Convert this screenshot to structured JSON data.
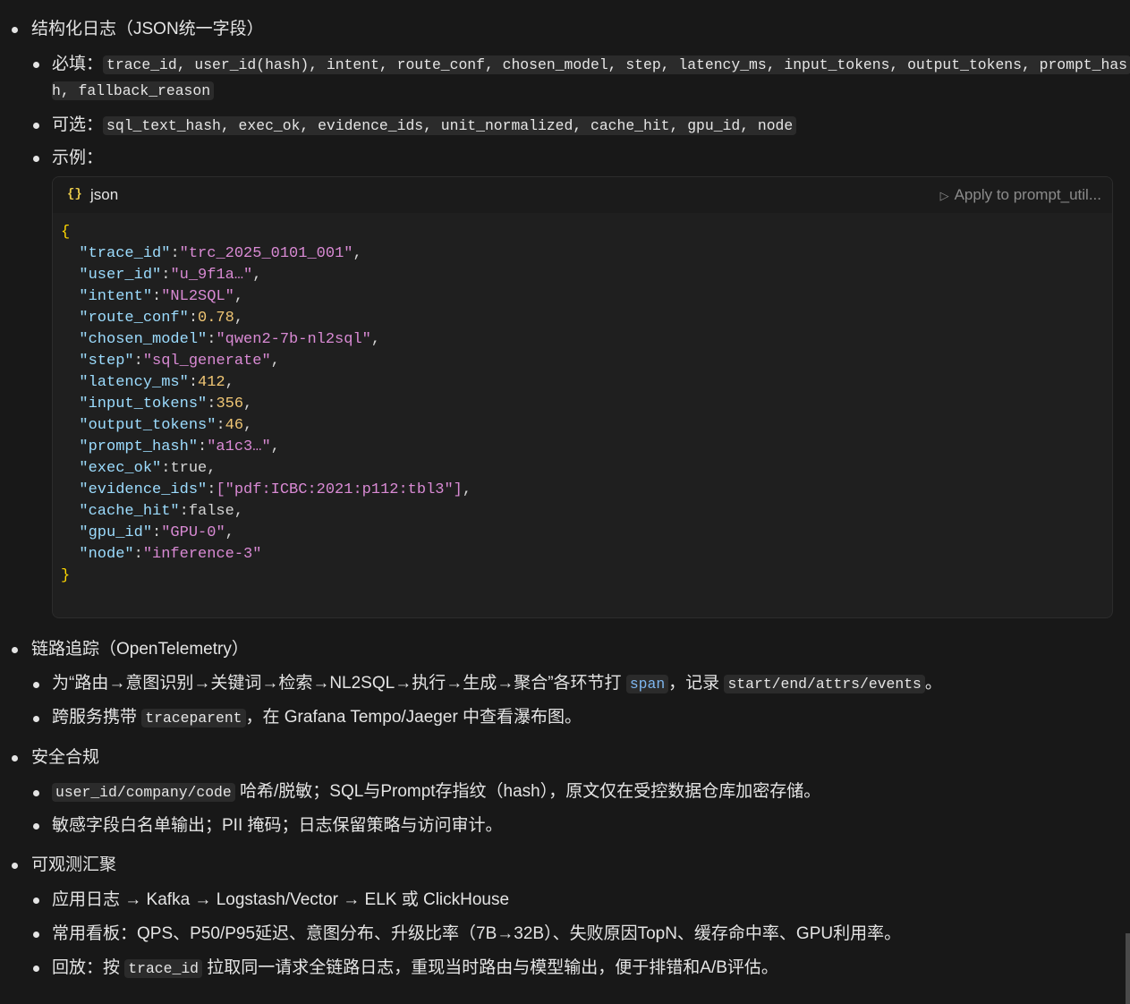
{
  "sections": {
    "structured_log": {
      "title": "结构化日志（JSON统一字段）",
      "required_label": "必填：",
      "required_fields_1": "trace_id, user_id(hash), intent, route_conf, chosen_model, step, latency_ms, input_tokens, output_tokens, prompt_has",
      "required_fields_2": "h, fallback_reason",
      "optional_label": "可选：",
      "optional_fields": "sql_text_hash, exec_ok, evidence_ids, unit_normalized, cache_hit, gpu_id, node",
      "example_label": "示例："
    },
    "tracing": {
      "title": "链路追踪（OpenTelemetry）",
      "b1_pre": "为“路由→意图识别→关键词→检索→NL2SQL→执行→生成→聚合”各环节打",
      "b1_code1": "span",
      "b1_mid": "，记录",
      "b1_code2": "start/end/attrs/events",
      "b1_post": "。",
      "b2_pre": "跨服务携带",
      "b2_code": "traceparent",
      "b2_post": "，在 Grafana Tempo/Jaeger 中查看瀑布图。"
    },
    "security": {
      "title": "安全合规",
      "b1_code": "user_id/company/code",
      "b1_post": "哈希/脱敏；SQL与Prompt存指纹（hash），原文仅在受控数据仓库加密存储。",
      "b2": "敏感字段白名单输出；PII 掩码；日志保留策略与访问审计。"
    },
    "observability": {
      "title": "可观测汇聚",
      "b1": "应用日志 → Kafka → Logstash/Vector → ELK 或 ClickHouse",
      "b2": "常用看板：QPS、P50/P95延迟、意图分布、升级比率（7B→32B）、失败原因TopN、缓存命中率、GPU利用率。",
      "b3_pre": "回放：按",
      "b3_code": "trace_id",
      "b3_post": "拉取同一请求全链路日志，重现当时路由与模型输出，便于排错和A/B评估。"
    }
  },
  "code_block": {
    "icon": "{}",
    "language": "json",
    "apply_label": "Apply to prompt_util...",
    "open_brace": "{",
    "close_brace": "}",
    "entries": [
      {
        "key": "\"trace_id\"",
        "value": "\"trc_2025_0101_001\"",
        "type": "s",
        "comma": ","
      },
      {
        "key": "\"user_id\"",
        "value": "\"u_9f1a…\"",
        "type": "s",
        "comma": ","
      },
      {
        "key": "\"intent\"",
        "value": "\"NL2SQL\"",
        "type": "s",
        "comma": ","
      },
      {
        "key": "\"route_conf\"",
        "value": "0.78",
        "type": "n",
        "comma": ","
      },
      {
        "key": "\"chosen_model\"",
        "value": "\"qwen2-7b-nl2sql\"",
        "type": "s",
        "comma": ","
      },
      {
        "key": "\"step\"",
        "value": "\"sql_generate\"",
        "type": "s",
        "comma": ","
      },
      {
        "key": "\"latency_ms\"",
        "value": "412",
        "type": "n",
        "comma": ","
      },
      {
        "key": "\"input_tokens\"",
        "value": "356",
        "type": "n",
        "comma": ","
      },
      {
        "key": "\"output_tokens\"",
        "value": "46",
        "type": "n",
        "comma": ","
      },
      {
        "key": "\"prompt_hash\"",
        "value": "\"a1c3…\"",
        "type": "s",
        "comma": ","
      },
      {
        "key": "\"exec_ok\"",
        "value": "true",
        "type": "p",
        "comma": ","
      },
      {
        "key": "\"evidence_ids\"",
        "value": "[\"pdf:ICBC:2021:p112:tbl3\"]",
        "type": "s",
        "comma": ","
      },
      {
        "key": "\"cache_hit\"",
        "value": "false",
        "type": "p",
        "comma": ","
      },
      {
        "key": "\"gpu_id\"",
        "value": "\"GPU-0\"",
        "type": "s",
        "comma": ","
      },
      {
        "key": "\"node\"",
        "value": "\"inference-3\"",
        "type": "s",
        "comma": ""
      }
    ]
  },
  "colors": {
    "background": "#181818",
    "code_key": "#9cdcfe",
    "code_string": "#d98ad4",
    "code_number": "#f0c674",
    "brace": "#ffd700"
  }
}
